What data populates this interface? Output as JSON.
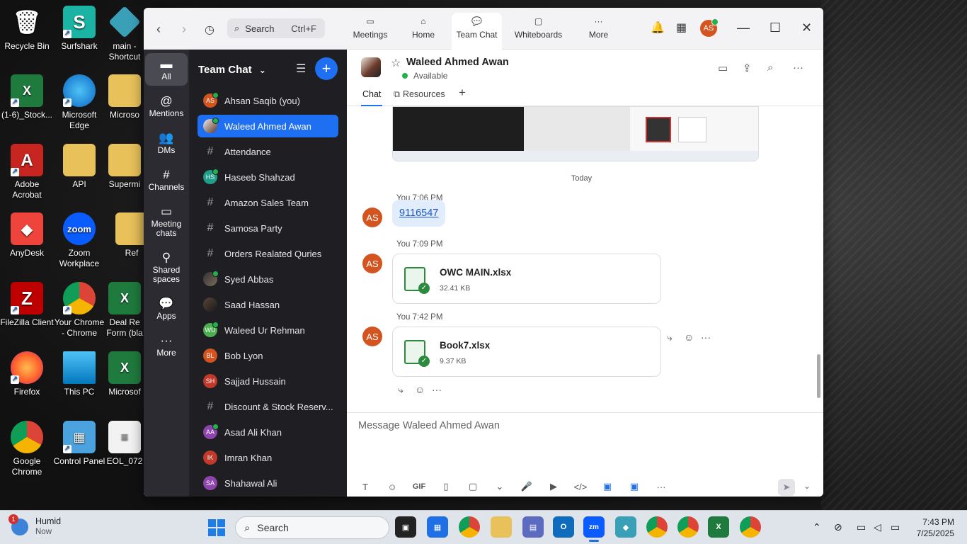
{
  "desktop": {
    "icons": [
      {
        "label": "Recycle Bin"
      },
      {
        "label": "Surfshark"
      },
      {
        "label": "main - Shortcut"
      },
      {
        "label": "(1-6)_Stock..."
      },
      {
        "label": "Microsoft Edge"
      },
      {
        "label": "Microso"
      },
      {
        "label": "Adobe Acrobat"
      },
      {
        "label": "API"
      },
      {
        "label": "Supermi"
      },
      {
        "label": "AnyDesk"
      },
      {
        "label": "Zoom Workplace"
      },
      {
        "label": "Ref"
      },
      {
        "label": "FileZilla Client"
      },
      {
        "label": "Your Chrome - Chrome"
      },
      {
        "label": "Deal Re Form (bla"
      },
      {
        "label": "Firefox"
      },
      {
        "label": "This PC"
      },
      {
        "label": "Microsof"
      },
      {
        "label": "Google Chrome"
      },
      {
        "label": "Control Panel"
      },
      {
        "label": "EOL_072"
      }
    ]
  },
  "zoom": {
    "search": {
      "label": "Search",
      "shortcut": "Ctrl+F"
    },
    "tabs": [
      {
        "label": "Meetings",
        "icon": "video-icon"
      },
      {
        "label": "Home",
        "icon": "home-icon"
      },
      {
        "label": "Team Chat",
        "icon": "chat-icon"
      },
      {
        "label": "Whiteboards",
        "icon": "whiteboard-icon"
      },
      {
        "label": "More",
        "icon": "more-icon"
      }
    ],
    "user_initials": "AS",
    "rail": [
      {
        "label": "All"
      },
      {
        "label": "Mentions"
      },
      {
        "label": "DMs"
      },
      {
        "label": "Channels"
      },
      {
        "label": "Meeting chats"
      },
      {
        "label": "Shared spaces"
      },
      {
        "label": "Apps"
      },
      {
        "label": "More"
      }
    ],
    "chatlist": {
      "title": "Team Chat",
      "items": [
        {
          "label": "Ahsan Saqib (you)",
          "initials": "AS"
        },
        {
          "label": "Waleed Ahmed Awan",
          "initials": ""
        },
        {
          "label": "Attendance",
          "initials": "#"
        },
        {
          "label": "Haseeb Shahzad",
          "initials": "HS"
        },
        {
          "label": "Amazon Sales Team",
          "initials": "#"
        },
        {
          "label": "Samosa Party",
          "initials": "#"
        },
        {
          "label": "Orders Realated Quries",
          "initials": "#"
        },
        {
          "label": "Syed Abbas",
          "initials": ""
        },
        {
          "label": "Saad Hassan",
          "initials": ""
        },
        {
          "label": "Waleed Ur Rehman",
          "initials": "WU"
        },
        {
          "label": "Bob Lyon",
          "initials": "BL"
        },
        {
          "label": "Sajjad Hussain",
          "initials": "SH"
        },
        {
          "label": "Discount & Stock Reserv...",
          "initials": "#"
        },
        {
          "label": "Asad Ali Khan",
          "initials": "AA"
        },
        {
          "label": "Imran Khan",
          "initials": "IK"
        },
        {
          "label": "Shahawal Ali",
          "initials": "SA"
        }
      ]
    },
    "conversation": {
      "name": "Waleed Ahmed Awan",
      "status": "Available",
      "tabs": [
        "Chat",
        "Resources"
      ],
      "today_label": "Today",
      "messages": [
        {
          "meta": "You 7:06 PM",
          "avatar": "AS",
          "link": "9116547"
        },
        {
          "meta": "You 7:09 PM",
          "avatar": "AS",
          "file_name": "OWC MAIN.xlsx",
          "file_size": "32.41 KB"
        },
        {
          "meta": "You 7:42 PM",
          "avatar": "AS",
          "file_name": "Book7.xlsx",
          "file_size": "9.37 KB"
        }
      ],
      "composer_placeholder": "Message Waleed Ahmed Awan",
      "composer_tools": [
        "T",
        "☺",
        "GIF",
        "▯",
        "▢",
        "⌄",
        "🎤",
        "▶",
        "</>",
        "▣",
        "▣",
        "···"
      ]
    }
  },
  "taskbar": {
    "weather_title": "Humid",
    "weather_sub": "Now",
    "notification_count": "1",
    "search_label": "Search",
    "time": "7:43 PM",
    "date": "7/25/2025"
  }
}
